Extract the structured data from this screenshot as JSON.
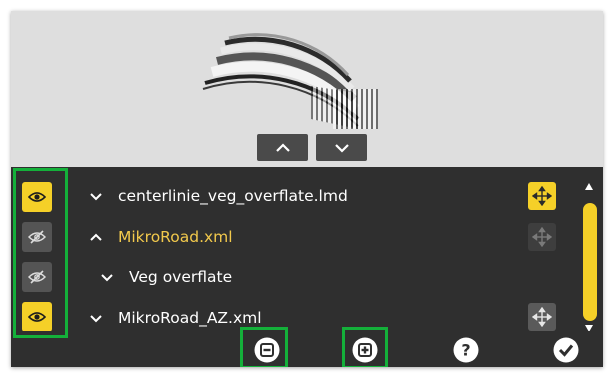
{
  "preview": {
    "up_icon": "chevron-up-icon",
    "down_icon": "chevron-down-icon"
  },
  "visibility": [
    {
      "state": "visible",
      "icon": "eye-icon"
    },
    {
      "state": "hidden",
      "icon": "eye-off-icon"
    },
    {
      "state": "hidden",
      "icon": "eye-off-icon"
    },
    {
      "state": "visible",
      "icon": "eye-icon"
    }
  ],
  "tree": [
    {
      "label": "centerlinie_veg_overflate.lmd",
      "expanded": false,
      "active": false,
      "level": 0
    },
    {
      "label": "MikroRoad.xml",
      "expanded": true,
      "active": true,
      "level": 0
    },
    {
      "label": "Veg overflate",
      "expanded": false,
      "active": false,
      "level": 1
    },
    {
      "label": "MikroRoad_AZ.xml",
      "expanded": false,
      "active": false,
      "level": 0
    }
  ],
  "move_buttons": [
    {
      "state": "active",
      "icon": "move-icon"
    },
    {
      "state": "disabled",
      "icon": "move-icon"
    },
    {
      "state": "normal",
      "icon": "move-icon"
    }
  ],
  "toolbar": {
    "remove_icon": "minus-box-icon",
    "add_icon": "plus-box-icon",
    "help_icon": "question-icon",
    "confirm_icon": "checkmark-icon"
  },
  "colors": {
    "accent": "#f5d028",
    "active_text": "#f2c94c",
    "highlight": "#14b03a",
    "panel": "#2f2f2f",
    "preview": "#dedede"
  }
}
